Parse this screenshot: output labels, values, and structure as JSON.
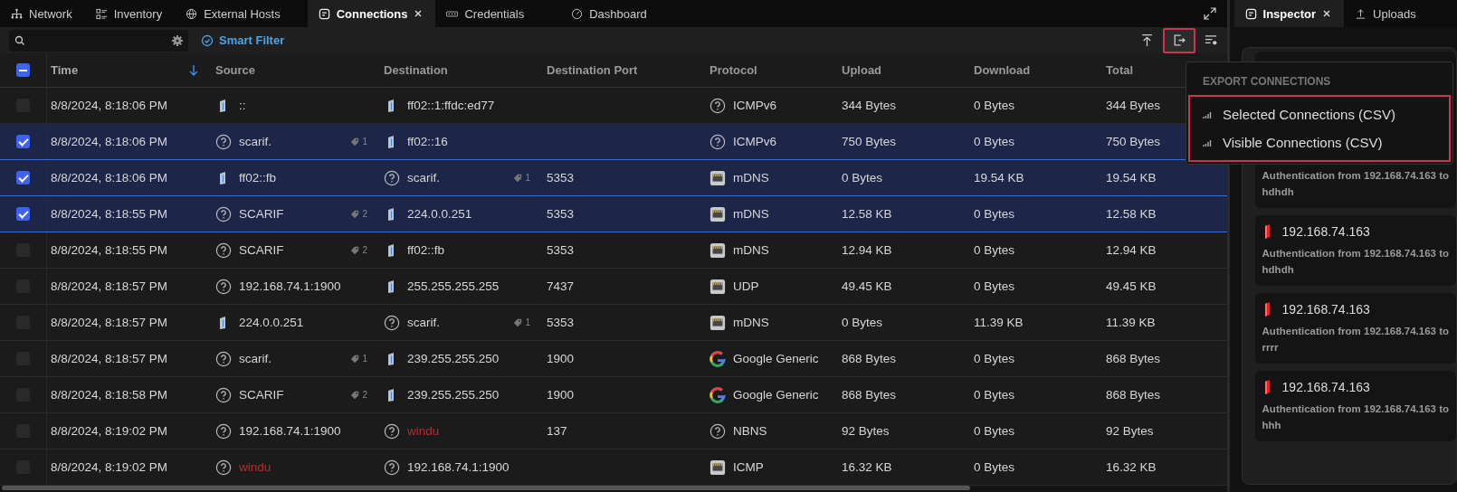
{
  "tabs": [
    {
      "label": "Network",
      "selected": false,
      "closable": false
    },
    {
      "label": "Inventory",
      "selected": false,
      "closable": false
    },
    {
      "label": "External Hosts",
      "selected": false,
      "closable": false
    },
    {
      "label": "Connections",
      "selected": true,
      "closable": true
    },
    {
      "label": "Credentials",
      "selected": false,
      "closable": false
    },
    {
      "label": "Dashboard",
      "selected": false,
      "closable": false
    }
  ],
  "toolbar": {
    "smart_filter": "Smart Filter"
  },
  "table": {
    "select_all_indeterminate": true,
    "columns": [
      {
        "label": "Time",
        "sorted": true
      },
      {
        "label": "Source",
        "sorted": false
      },
      {
        "label": "Destination",
        "sorted": false
      },
      {
        "label": "Destination Port",
        "sorted": false
      },
      {
        "label": "Protocol",
        "sorted": false
      },
      {
        "label": "Upload",
        "sorted": false
      },
      {
        "label": "Download",
        "sorted": false
      },
      {
        "label": "Total",
        "sorted": false
      }
    ],
    "rows": [
      {
        "selected": false,
        "time": "8/8/2024, 8:18:06 PM",
        "source": {
          "kind": "device",
          "text": "::",
          "alert": false
        },
        "destination": {
          "kind": "device",
          "text": "ff02::1:ffdc:ed77",
          "alert": false
        },
        "port": "",
        "protocol": {
          "kind": "unknown",
          "text": "ICMPv6"
        },
        "upload": "344 Bytes",
        "download": "0 Bytes",
        "total": "344 Bytes"
      },
      {
        "selected": true,
        "time": "8/8/2024, 8:18:06 PM",
        "source": {
          "kind": "unknown",
          "text": "scarif.",
          "tags": "1",
          "alert": false
        },
        "destination": {
          "kind": "device",
          "text": "ff02::16",
          "alert": false
        },
        "port": "",
        "protocol": {
          "kind": "unknown",
          "text": "ICMPv6"
        },
        "upload": "750 Bytes",
        "download": "0 Bytes",
        "total": "750 Bytes"
      },
      {
        "selected": true,
        "time": "8/8/2024, 8:18:06 PM",
        "source": {
          "kind": "device",
          "text": "ff02::fb",
          "alert": false
        },
        "destination": {
          "kind": "unknown",
          "text": "scarif.",
          "tags": "1",
          "alert": false
        },
        "port": "5353",
        "protocol": {
          "kind": "network",
          "text": "mDNS"
        },
        "upload": "0 Bytes",
        "download": "19.54 KB",
        "total": "19.54 KB"
      },
      {
        "selected": true,
        "time": "8/8/2024, 8:18:55 PM",
        "source": {
          "kind": "unknown",
          "text": "SCARIF",
          "tags": "2",
          "alert": false
        },
        "destination": {
          "kind": "device",
          "text": "224.0.0.251",
          "alert": false
        },
        "port": "5353",
        "protocol": {
          "kind": "network",
          "text": "mDNS"
        },
        "upload": "12.58 KB",
        "download": "0 Bytes",
        "total": "12.58 KB"
      },
      {
        "selected": false,
        "time": "8/8/2024, 8:18:55 PM",
        "source": {
          "kind": "unknown",
          "text": "SCARIF",
          "tags": "2",
          "alert": false
        },
        "destination": {
          "kind": "device",
          "text": "ff02::fb",
          "alert": false
        },
        "port": "5353",
        "protocol": {
          "kind": "network",
          "text": "mDNS"
        },
        "upload": "12.94 KB",
        "download": "0 Bytes",
        "total": "12.94 KB"
      },
      {
        "selected": false,
        "time": "8/8/2024, 8:18:57 PM",
        "source": {
          "kind": "unknown",
          "text": "192.168.74.1:1900",
          "alert": false
        },
        "destination": {
          "kind": "device",
          "text": "255.255.255.255",
          "alert": false
        },
        "port": "7437",
        "protocol": {
          "kind": "network",
          "text": "UDP"
        },
        "upload": "49.45 KB",
        "download": "0 Bytes",
        "total": "49.45 KB"
      },
      {
        "selected": false,
        "time": "8/8/2024, 8:18:57 PM",
        "source": {
          "kind": "device",
          "text": "224.0.0.251",
          "alert": false
        },
        "destination": {
          "kind": "unknown",
          "text": "scarif.",
          "tags": "1",
          "alert": false
        },
        "port": "5353",
        "protocol": {
          "kind": "network",
          "text": "mDNS"
        },
        "upload": "0 Bytes",
        "download": "11.39 KB",
        "total": "11.39 KB"
      },
      {
        "selected": false,
        "time": "8/8/2024, 8:18:57 PM",
        "source": {
          "kind": "unknown",
          "text": "scarif.",
          "tags": "1",
          "alert": false
        },
        "destination": {
          "kind": "device",
          "text": "239.255.255.250",
          "alert": false
        },
        "port": "1900",
        "protocol": {
          "kind": "google",
          "text": "Google Generic"
        },
        "upload": "868 Bytes",
        "download": "0 Bytes",
        "total": "868 Bytes"
      },
      {
        "selected": false,
        "time": "8/8/2024, 8:18:58 PM",
        "source": {
          "kind": "unknown",
          "text": "SCARIF",
          "tags": "2",
          "alert": false
        },
        "destination": {
          "kind": "device",
          "text": "239.255.255.250",
          "alert": false
        },
        "port": "1900",
        "protocol": {
          "kind": "google",
          "text": "Google Generic"
        },
        "upload": "868 Bytes",
        "download": "0 Bytes",
        "total": "868 Bytes"
      },
      {
        "selected": false,
        "time": "8/8/2024, 8:19:02 PM",
        "source": {
          "kind": "unknown",
          "text": "192.168.74.1:1900",
          "alert": false
        },
        "destination": {
          "kind": "unknown",
          "text": "windu",
          "alert": true
        },
        "port": "137",
        "protocol": {
          "kind": "unknown",
          "text": "NBNS"
        },
        "upload": "92 Bytes",
        "download": "0 Bytes",
        "total": "92 Bytes"
      },
      {
        "selected": false,
        "time": "8/8/2024, 8:19:02 PM",
        "source": {
          "kind": "unknown",
          "text": "windu",
          "alert": true
        },
        "destination": {
          "kind": "unknown",
          "text": "192.168.74.1:1900",
          "alert": false
        },
        "port": "",
        "protocol": {
          "kind": "network",
          "text": "ICMP"
        },
        "upload": "16.32 KB",
        "download": "0 Bytes",
        "total": "16.32 KB"
      }
    ]
  },
  "export_menu": {
    "title": "EXPORT CONNECTIONS",
    "items": [
      "Selected Connections (CSV)",
      "Visible Connections (CSV)"
    ]
  },
  "inspector": {
    "tabs": [
      {
        "label": "Inspector",
        "selected": true,
        "closable": true
      },
      {
        "label": "Uploads",
        "selected": false,
        "closable": false
      }
    ],
    "cards": [
      {
        "lines": [
          "Authentication from 192.168.74.163 to",
          "hdhdh"
        ]
      },
      {
        "title": "192.168.74.163",
        "lines": [
          "Authentication from 192.168.74.163 to",
          "hdhdh"
        ]
      },
      {
        "title": "192.168.74.163",
        "lines": [
          "Authentication from 192.168.74.163 to",
          "rrrr"
        ]
      },
      {
        "title": "192.168.74.163",
        "lines": [
          "Authentication from 192.168.74.163 to",
          "hhh"
        ]
      }
    ]
  }
}
